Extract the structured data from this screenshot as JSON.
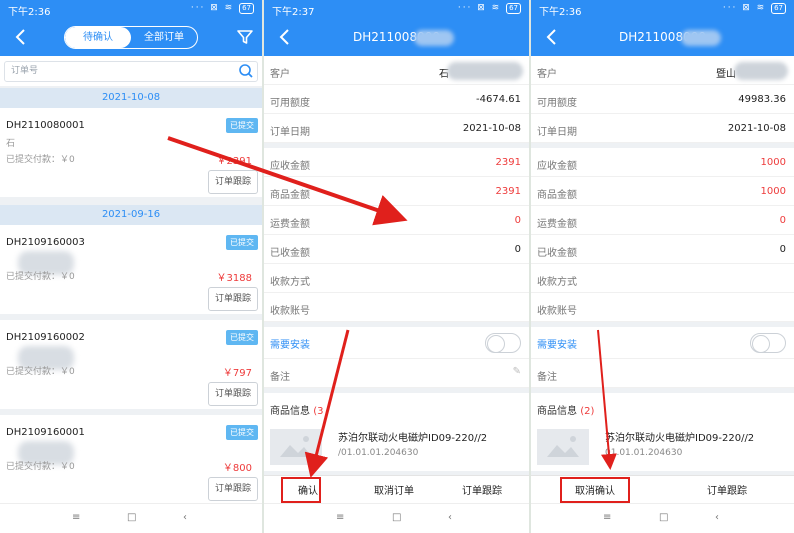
{
  "screen1": {
    "time": "下午2:36",
    "tabs": [
      "待确认",
      "全部订单"
    ],
    "search_placeholder": "订单号",
    "groups": [
      {
        "date": "2021-10-08",
        "orders": [
          {
            "code": "DH2110080001",
            "customer": "石",
            "paid": "已提交付款：￥0",
            "amount": "￥2391",
            "status": "已提交",
            "track": "订单跟踪"
          }
        ]
      },
      {
        "date": "2021-09-16",
        "orders": [
          {
            "code": "DH2109160003",
            "customer": "",
            "paid": "已提交付款：￥0",
            "amount": "￥3188",
            "status": "已提交",
            "track": "订单跟踪"
          },
          {
            "code": "DH2109160002",
            "customer": "",
            "paid": "已提交付款：￥0",
            "amount": "￥797",
            "status": "已提交",
            "track": "订单跟踪"
          },
          {
            "code": "DH2109160001",
            "customer": "",
            "paid": "已提交付款：￥0",
            "amount": "￥800",
            "status": "已提交",
            "track": "订单跟踪"
          }
        ]
      }
    ]
  },
  "screen2": {
    "time": "下午2:37",
    "title": "DH211008000",
    "fields": {
      "customer": {
        "label": "客户",
        "value": "石"
      },
      "credit": {
        "label": "可用额度",
        "value": "-4674.61"
      },
      "date": {
        "label": "订单日期",
        "value": "2021-10-08"
      },
      "receivable": {
        "label": "应收金额",
        "value": "2391"
      },
      "goods": {
        "label": "商品金额",
        "value": "2391"
      },
      "freight": {
        "label": "运费金额",
        "value": "0"
      },
      "received": {
        "label": "已收金额",
        "value": "0"
      },
      "pay_method": {
        "label": "收款方式",
        "value": ""
      },
      "pay_account": {
        "label": "收款账号",
        "value": ""
      },
      "install": {
        "label": "需要安装"
      },
      "remark": {
        "label": "备注"
      }
    },
    "products_label": "商品信息",
    "products_count": "(3",
    "product": {
      "name": "苏泊尔联动火电磁炉ID09-220//2",
      "code": "/01.01.01.204630"
    },
    "actions": {
      "confirm": "确认",
      "cancel": "取消订单",
      "track": "订单跟踪"
    }
  },
  "screen3": {
    "time": "下午2:36",
    "title": "DH211008000",
    "fields": {
      "customer": {
        "label": "客户",
        "value": "暨山"
      },
      "credit": {
        "label": "可用额度",
        "value": "49983.36"
      },
      "date": {
        "label": "订单日期",
        "value": "2021-10-08"
      },
      "receivable": {
        "label": "应收金额",
        "value": "1000"
      },
      "goods": {
        "label": "商品金额",
        "value": "1000"
      },
      "freight": {
        "label": "运费金额",
        "value": "0"
      },
      "received": {
        "label": "已收金额",
        "value": "0"
      },
      "pay_method": {
        "label": "收款方式",
        "value": ""
      },
      "pay_account": {
        "label": "收款账号",
        "value": ""
      },
      "install": {
        "label": "需要安装"
      },
      "remark": {
        "label": "备注"
      }
    },
    "products_label": "商品信息",
    "products_count": "(2)",
    "product": {
      "name": "苏泊尔联动火电磁炉ID09-220//2",
      "code": "01.01.01.204630"
    },
    "actions": {
      "cancel_confirm": "取消确认",
      "track": "订单跟踪"
    }
  },
  "navkeys": [
    "≡",
    "□",
    "‹"
  ],
  "colors": {
    "primary": "#2d8ef5",
    "accent_red": "#ee3b3b",
    "annotation_red": "#e0201c"
  }
}
